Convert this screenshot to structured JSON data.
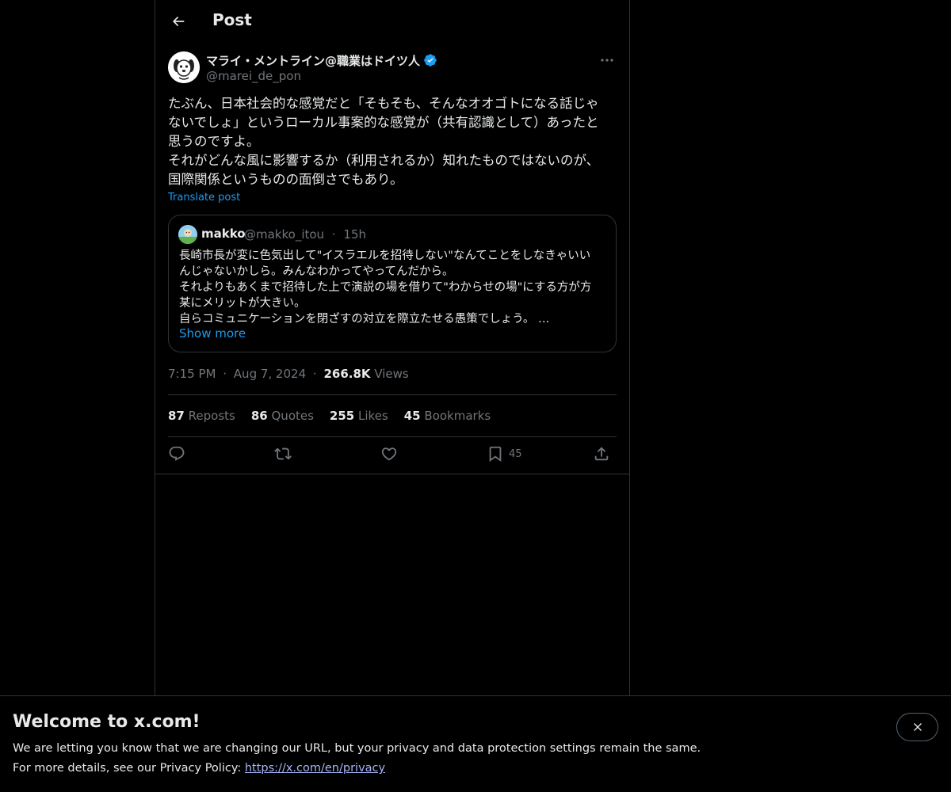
{
  "header": {
    "title": "Post"
  },
  "post": {
    "author_name": "マライ・メントライン@職業はドイツ人",
    "author_handle": "@marei_de_pon",
    "text_lines": [
      "たぶん、日本社会的な感覚だと「そもそも、そんなオオゴトになる話じゃ",
      "ないでしょ」というローカル事案的な感覚が（共有認識として）あったと",
      "思うのですよ。",
      "それがどんな風に影響するか（利用されるか）知れたものではないのが、",
      "国際関係というものの面倒さでもあり。"
    ],
    "translate_label": "Translate post",
    "time": "7:15 PM",
    "date": "Aug 7, 2024",
    "views_count": "266.8K",
    "views_label": "Views",
    "separator": "·"
  },
  "quote": {
    "author_name": "makko",
    "author_handle": "@makko_itou",
    "time": "15h",
    "text_lines": [
      "長崎市長が変に色気出して\"イスラエルを招待しない\"なんてことをしなきゃいい",
      "んじゃないかしら。みんなわかってやってんだから。",
      "それよりもあくまで招待した上で演説の場を借りて\"わからせの場\"にする方が方",
      "某にメリットが大きい。",
      "自らコミュニケーションを閉ざすの対立を際立たせる愚策でしょう。 …"
    ],
    "show_more": "Show more"
  },
  "stats": {
    "reposts_count": "87",
    "reposts_label": "Reposts",
    "quotes_count": "86",
    "quotes_label": "Quotes",
    "likes_count": "255",
    "likes_label": "Likes",
    "bookmarks_count": "45",
    "bookmarks_label": "Bookmarks"
  },
  "actions": {
    "bookmark_count": "45"
  },
  "banner": {
    "title": "Welcome to x.com!",
    "line1": "We are letting you know that we are changing our URL, but your privacy and data protection settings remain the same.",
    "line2_prefix": "For more details, see our Privacy Policy: ",
    "link": "https://x.com/en/privacy"
  },
  "colors": {
    "accent": "#1d9bf0",
    "muted": "#71767b",
    "border": "#2f3336",
    "background": "#000000"
  },
  "icons": [
    "back-arrow-icon",
    "verified-badge-icon",
    "more-icon",
    "reply-icon",
    "repost-icon",
    "like-icon",
    "bookmark-icon",
    "share-icon",
    "close-icon"
  ]
}
